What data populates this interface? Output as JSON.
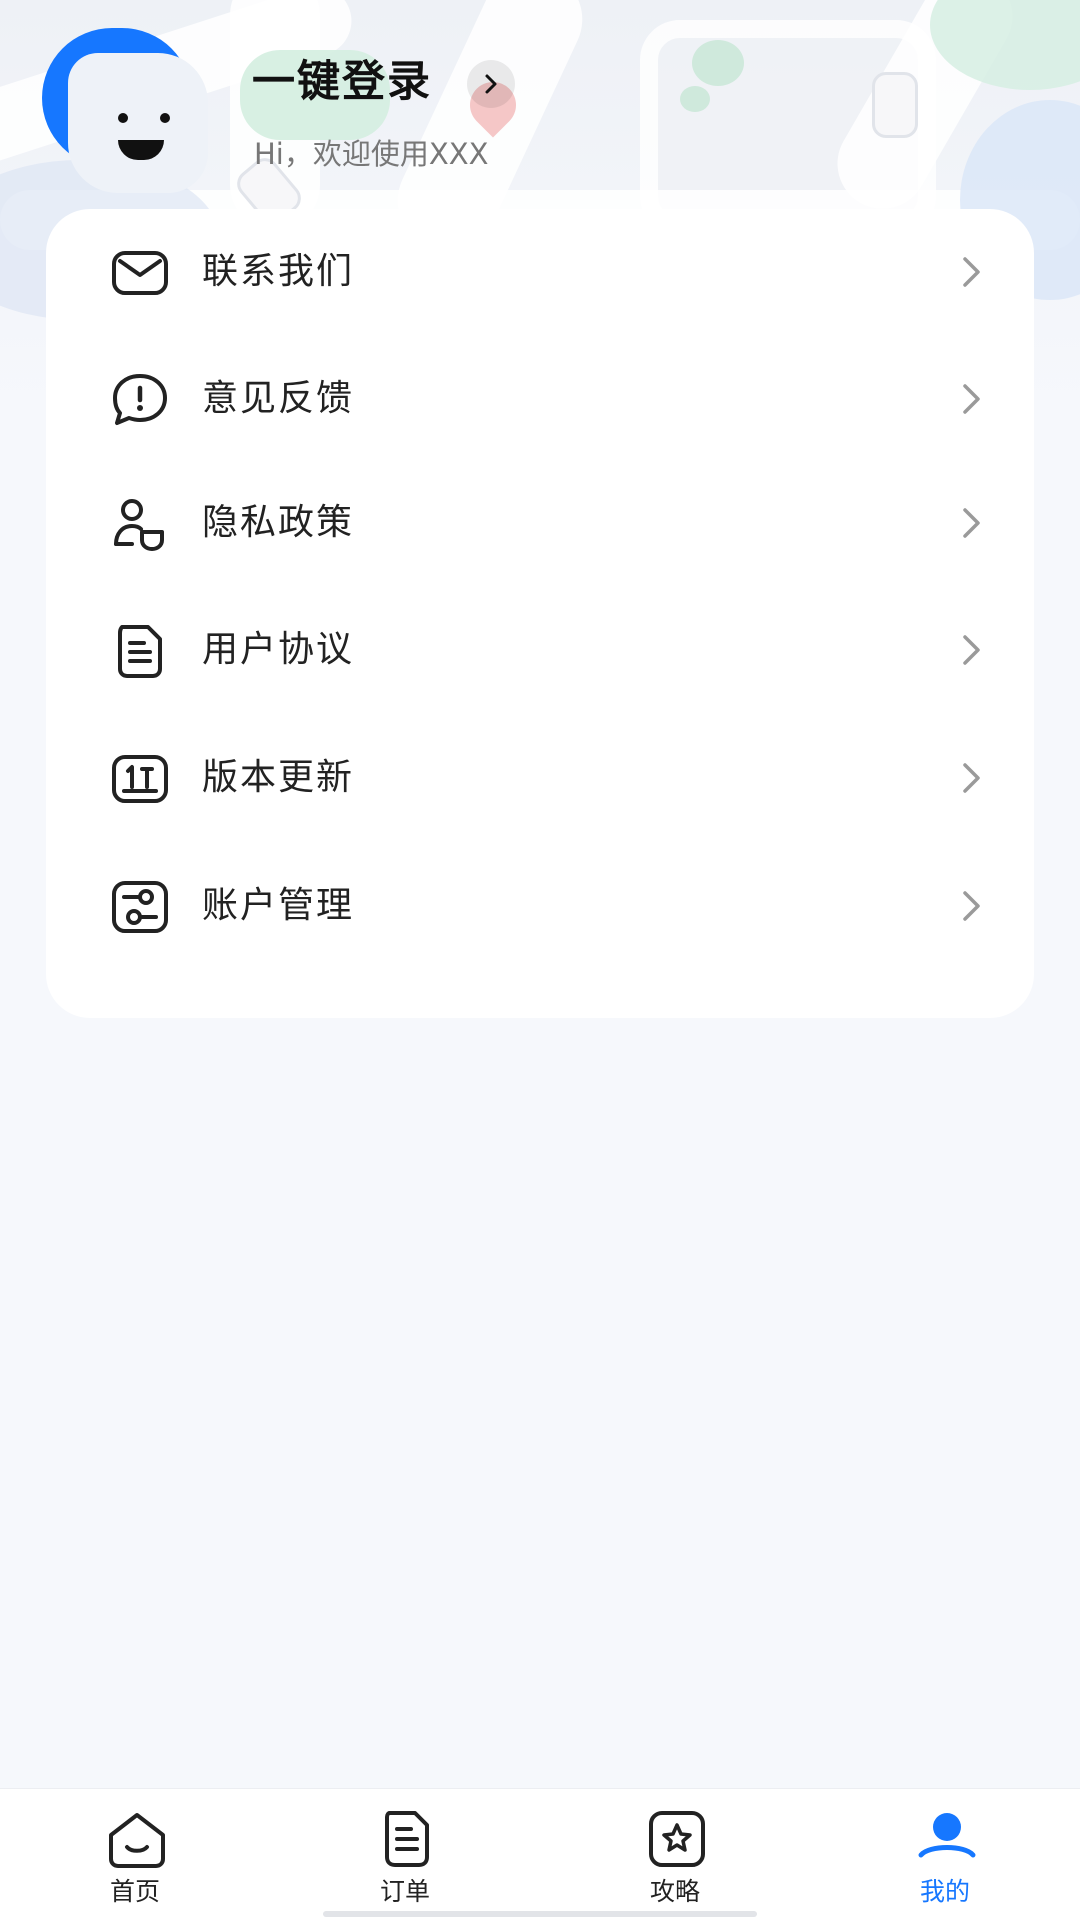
{
  "header": {
    "login_title": "一键登录",
    "subtitle": "Hi，欢迎使用XXX"
  },
  "menu": {
    "items": [
      {
        "label": "联系我们",
        "icon": "mail-icon"
      },
      {
        "label": "意见反馈",
        "icon": "feedback-icon"
      },
      {
        "label": "隐私政策",
        "icon": "privacy-icon"
      },
      {
        "label": "用户协议",
        "icon": "document-icon"
      },
      {
        "label": "版本更新",
        "icon": "update-icon"
      },
      {
        "label": "账户管理",
        "icon": "account-settings-icon"
      }
    ]
  },
  "tabbar": {
    "tabs": [
      {
        "label": "首页",
        "icon": "home-icon",
        "active": false
      },
      {
        "label": "订单",
        "icon": "orders-icon",
        "active": false
      },
      {
        "label": "攻略",
        "icon": "guide-icon",
        "active": false
      },
      {
        "label": "我的",
        "icon": "profile-icon",
        "active": true
      }
    ]
  },
  "colors": {
    "accent": "#1677ff",
    "background": "#f6f8fc",
    "card": "#ffffff",
    "text": "#222222",
    "muted": "#777777",
    "arrow": "#9a9a9a"
  }
}
